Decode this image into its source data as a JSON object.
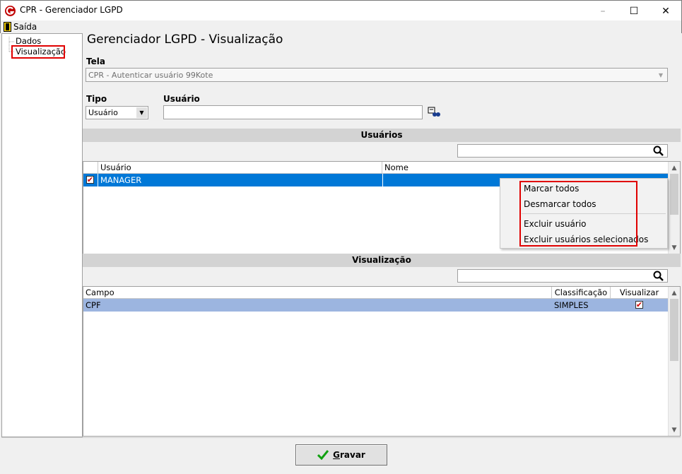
{
  "window": {
    "title": "CPR - Gerenciador LGPD",
    "minimize_glyph": "–",
    "maximize_glyph": "☐",
    "close_glyph": "✕"
  },
  "menu": {
    "saida": "Saída"
  },
  "tree": {
    "items": [
      {
        "label": "Dados"
      },
      {
        "label": "Visualização"
      }
    ]
  },
  "page": {
    "title": "Gerenciador LGPD - Visualização"
  },
  "tela": {
    "label": "Tela",
    "value": "CPR - Autenticar usuário 99Kote"
  },
  "tipo": {
    "label": "Tipo",
    "value": "Usuário"
  },
  "usuario": {
    "label": "Usuário",
    "value": ""
  },
  "usuarios_section": {
    "title": "Usuários",
    "search_value": "",
    "columns": [
      "Usuário",
      "Nome"
    ],
    "rows": [
      {
        "checked": true,
        "usuario": "MANAGER",
        "nome": ""
      }
    ]
  },
  "context_menu": {
    "items": [
      "Marcar todos",
      "Desmarcar todos",
      "Excluir usuário",
      "Excluir usuários selecionados"
    ]
  },
  "visualizacao_section": {
    "title": "Visualização",
    "search_value": "",
    "columns": [
      "Campo",
      "Classificação",
      "Visualizar"
    ],
    "rows": [
      {
        "campo": "CPF",
        "classificacao": "SIMPLES",
        "visualizar": true
      }
    ]
  },
  "footer": {
    "save_label": "Gravar"
  },
  "colors": {
    "selection": "#0078d7",
    "row_highlight": "#9cb5e0",
    "highlight_box": "#e00000"
  }
}
